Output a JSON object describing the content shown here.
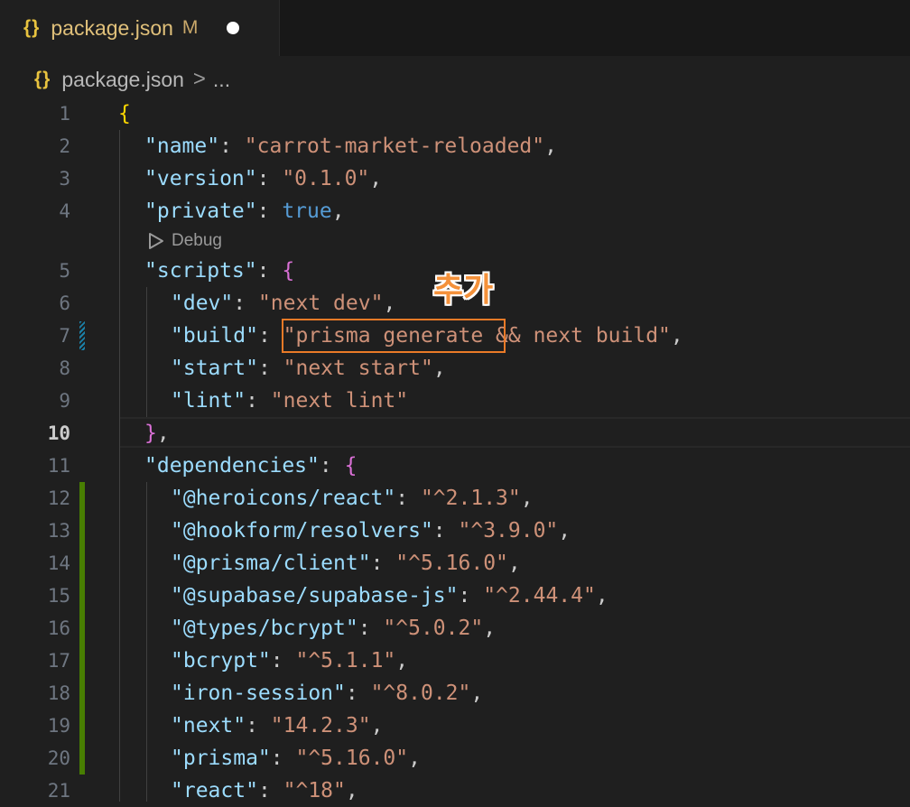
{
  "tab": {
    "icon": "{}",
    "filename": "package.json",
    "status": "M"
  },
  "breadcrumb": {
    "icon": "{}",
    "file": "package.json",
    "separator": ">",
    "more": "..."
  },
  "codelens": {
    "label": "Debug"
  },
  "annotation": {
    "text": "추가"
  },
  "active_line": "10",
  "lines": [
    {
      "n": "1",
      "tokens": [
        {
          "t": "brace1",
          "v": "{"
        }
      ]
    },
    {
      "n": "2",
      "tokens": [
        {
          "t": "key",
          "v": "\"name\""
        },
        {
          "t": "punc",
          "v": ": "
        },
        {
          "t": "str",
          "v": "\"carrot-market-reloaded\""
        },
        {
          "t": "punc",
          "v": ","
        }
      ]
    },
    {
      "n": "3",
      "tokens": [
        {
          "t": "key",
          "v": "\"version\""
        },
        {
          "t": "punc",
          "v": ": "
        },
        {
          "t": "str",
          "v": "\"0.1.0\""
        },
        {
          "t": "punc",
          "v": ","
        }
      ]
    },
    {
      "n": "4",
      "tokens": [
        {
          "t": "key",
          "v": "\"private\""
        },
        {
          "t": "punc",
          "v": ": "
        },
        {
          "t": "bool",
          "v": "true"
        },
        {
          "t": "punc",
          "v": ","
        }
      ]
    },
    {
      "n": "5",
      "tokens": [
        {
          "t": "key",
          "v": "\"scripts\""
        },
        {
          "t": "punc",
          "v": ": "
        },
        {
          "t": "brace2",
          "v": "{"
        }
      ]
    },
    {
      "n": "6",
      "tokens": [
        {
          "t": "key",
          "v": "\"dev\""
        },
        {
          "t": "punc",
          "v": ": "
        },
        {
          "t": "str",
          "v": "\"next dev\""
        },
        {
          "t": "punc",
          "v": ","
        }
      ]
    },
    {
      "n": "7",
      "tokens": [
        {
          "t": "key",
          "v": "\"build\""
        },
        {
          "t": "punc",
          "v": ": "
        },
        {
          "t": "str",
          "v": "\"prisma generate && next build\""
        },
        {
          "t": "punc",
          "v": ","
        }
      ]
    },
    {
      "n": "8",
      "tokens": [
        {
          "t": "key",
          "v": "\"start\""
        },
        {
          "t": "punc",
          "v": ": "
        },
        {
          "t": "str",
          "v": "\"next start\""
        },
        {
          "t": "punc",
          "v": ","
        }
      ]
    },
    {
      "n": "9",
      "tokens": [
        {
          "t": "key",
          "v": "\"lint\""
        },
        {
          "t": "punc",
          "v": ": "
        },
        {
          "t": "str",
          "v": "\"next lint\""
        }
      ]
    },
    {
      "n": "10",
      "tokens": [
        {
          "t": "brace2",
          "v": "}"
        },
        {
          "t": "punc",
          "v": ","
        }
      ]
    },
    {
      "n": "11",
      "tokens": [
        {
          "t": "key",
          "v": "\"dependencies\""
        },
        {
          "t": "punc",
          "v": ": "
        },
        {
          "t": "brace2",
          "v": "{"
        }
      ]
    },
    {
      "n": "12",
      "tokens": [
        {
          "t": "key",
          "v": "\"@heroicons/react\""
        },
        {
          "t": "punc",
          "v": ": "
        },
        {
          "t": "str",
          "v": "\"^2.1.3\""
        },
        {
          "t": "punc",
          "v": ","
        }
      ]
    },
    {
      "n": "13",
      "tokens": [
        {
          "t": "key",
          "v": "\"@hookform/resolvers\""
        },
        {
          "t": "punc",
          "v": ": "
        },
        {
          "t": "str",
          "v": "\"^3.9.0\""
        },
        {
          "t": "punc",
          "v": ","
        }
      ]
    },
    {
      "n": "14",
      "tokens": [
        {
          "t": "key",
          "v": "\"@prisma/client\""
        },
        {
          "t": "punc",
          "v": ": "
        },
        {
          "t": "str",
          "v": "\"^5.16.0\""
        },
        {
          "t": "punc",
          "v": ","
        }
      ]
    },
    {
      "n": "15",
      "tokens": [
        {
          "t": "key",
          "v": "\"@supabase/supabase-js\""
        },
        {
          "t": "punc",
          "v": ": "
        },
        {
          "t": "str",
          "v": "\"^2.44.4\""
        },
        {
          "t": "punc",
          "v": ","
        }
      ]
    },
    {
      "n": "16",
      "tokens": [
        {
          "t": "key",
          "v": "\"@types/bcrypt\""
        },
        {
          "t": "punc",
          "v": ": "
        },
        {
          "t": "str",
          "v": "\"^5.0.2\""
        },
        {
          "t": "punc",
          "v": ","
        }
      ]
    },
    {
      "n": "17",
      "tokens": [
        {
          "t": "key",
          "v": "\"bcrypt\""
        },
        {
          "t": "punc",
          "v": ": "
        },
        {
          "t": "str",
          "v": "\"^5.1.1\""
        },
        {
          "t": "punc",
          "v": ","
        }
      ]
    },
    {
      "n": "18",
      "tokens": [
        {
          "t": "key",
          "v": "\"iron-session\""
        },
        {
          "t": "punc",
          "v": ": "
        },
        {
          "t": "str",
          "v": "\"^8.0.2\""
        },
        {
          "t": "punc",
          "v": ","
        }
      ]
    },
    {
      "n": "19",
      "tokens": [
        {
          "t": "key",
          "v": "\"next\""
        },
        {
          "t": "punc",
          "v": ": "
        },
        {
          "t": "str",
          "v": "\"14.2.3\""
        },
        {
          "t": "punc",
          "v": ","
        }
      ]
    },
    {
      "n": "20",
      "tokens": [
        {
          "t": "key",
          "v": "\"prisma\""
        },
        {
          "t": "punc",
          "v": ": "
        },
        {
          "t": "str",
          "v": "\"^5.16.0\""
        },
        {
          "t": "punc",
          "v": ","
        }
      ]
    },
    {
      "n": "21",
      "tokens": [
        {
          "t": "key",
          "v": "\"react\""
        },
        {
          "t": "punc",
          "v": ": "
        },
        {
          "t": "str",
          "v": "\"^18\""
        },
        {
          "t": "punc",
          "v": ","
        }
      ]
    }
  ]
}
